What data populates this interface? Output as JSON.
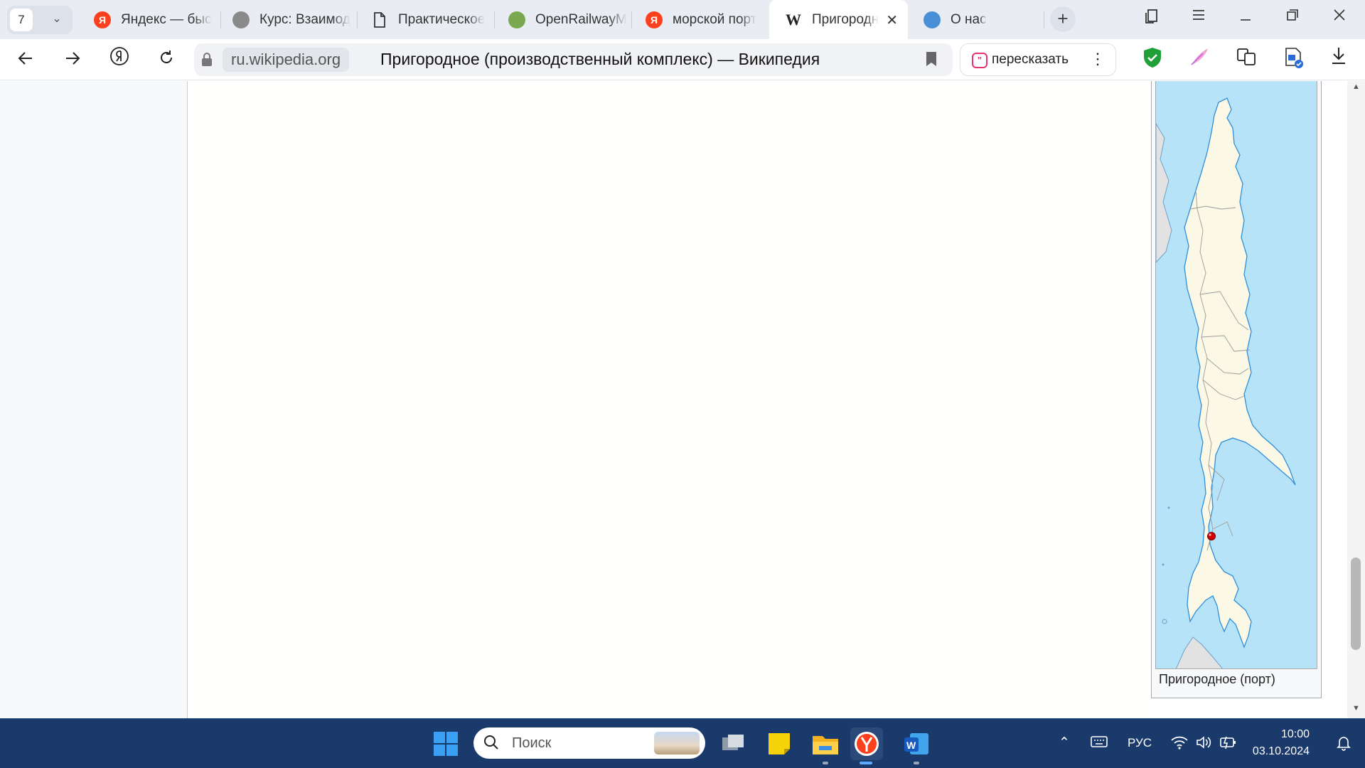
{
  "browser": {
    "tab_count": "7",
    "tabs": [
      {
        "title": "Яндекс — быс",
        "favicon": "yandex-icon"
      },
      {
        "title": "Курс: Взаимод",
        "favicon": "course-icon"
      },
      {
        "title": "Практическое",
        "favicon": "document-icon"
      },
      {
        "title": "OpenRailwayM",
        "favicon": "openrailwaymap-icon"
      },
      {
        "title": "морской порт",
        "favicon": "yandex-icon"
      },
      {
        "title": "Пригородн",
        "favicon": "wikipedia-icon",
        "active": true
      },
      {
        "title": "О нас",
        "favicon": "globe-icon"
      }
    ],
    "tab_glyphs": {
      "yandex": "Я",
      "wikipedia": "W",
      "close": "✕"
    },
    "address": {
      "domain": "ru.wikipedia.org",
      "page_title": "Пригородное (производственный комплекс) — Википедия"
    },
    "retell_button": {
      "label": "пересказать"
    },
    "accent_color": "#fc3f1d"
  },
  "page": {
    "infobox": {
      "map_caption": "Пригородное (порт)",
      "marker_color": "#d40000",
      "sea_color": "#b7e3f9",
      "land_color": "#fbf8e6"
    }
  },
  "taskbar": {
    "search_placeholder": "Поиск",
    "language": "РУС",
    "time": "10:00",
    "date": "03.10.2024"
  }
}
